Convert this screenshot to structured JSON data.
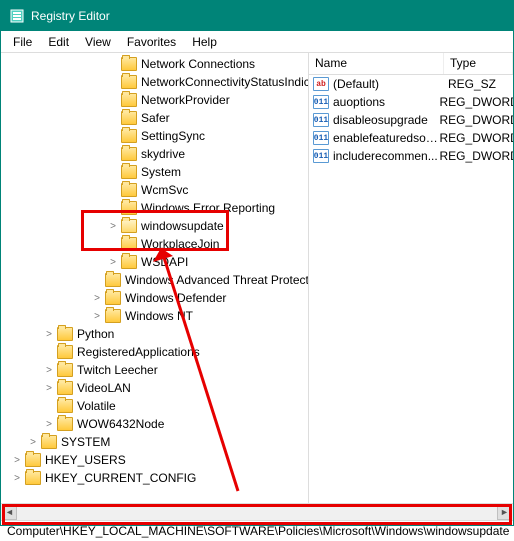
{
  "window": {
    "title": "Registry Editor"
  },
  "menu": {
    "items": [
      "File",
      "Edit",
      "View",
      "Favorites",
      "Help"
    ]
  },
  "tree": {
    "items": [
      {
        "indent": 106,
        "expander": "",
        "label": "Network Connections"
      },
      {
        "indent": 106,
        "expander": "",
        "label": "NetworkConnectivityStatusIndicator"
      },
      {
        "indent": 106,
        "expander": "",
        "label": "NetworkProvider"
      },
      {
        "indent": 106,
        "expander": "",
        "label": "Safer"
      },
      {
        "indent": 106,
        "expander": "",
        "label": "SettingSync"
      },
      {
        "indent": 106,
        "expander": "",
        "label": "skydrive"
      },
      {
        "indent": 106,
        "expander": "",
        "label": "System"
      },
      {
        "indent": 106,
        "expander": "",
        "label": "WcmSvc"
      },
      {
        "indent": 106,
        "expander": "",
        "label": "Windows Error Reporting"
      },
      {
        "indent": 106,
        "expander": ">",
        "label": "windowsupdate",
        "open": true
      },
      {
        "indent": 106,
        "expander": "",
        "label": "WorkplaceJoin"
      },
      {
        "indent": 106,
        "expander": ">",
        "label": "WSDAPI"
      },
      {
        "indent": 90,
        "expander": "",
        "label": "Windows Advanced Threat Protection"
      },
      {
        "indent": 90,
        "expander": ">",
        "label": "Windows Defender"
      },
      {
        "indent": 90,
        "expander": ">",
        "label": "Windows NT"
      },
      {
        "indent": 42,
        "expander": ">",
        "label": "Python"
      },
      {
        "indent": 42,
        "expander": "",
        "label": "RegisteredApplications"
      },
      {
        "indent": 42,
        "expander": ">",
        "label": "Twitch Leecher"
      },
      {
        "indent": 42,
        "expander": ">",
        "label": "VideoLAN"
      },
      {
        "indent": 42,
        "expander": "",
        "label": "Volatile"
      },
      {
        "indent": 42,
        "expander": ">",
        "label": "WOW6432Node"
      },
      {
        "indent": 26,
        "expander": ">",
        "label": "SYSTEM"
      },
      {
        "indent": 10,
        "expander": ">",
        "label": "HKEY_USERS"
      },
      {
        "indent": 10,
        "expander": ">",
        "label": "HKEY_CURRENT_CONFIG"
      }
    ]
  },
  "list": {
    "columns": {
      "name": "Name",
      "type": "Type"
    },
    "rows": [
      {
        "icon": "sz",
        "name": "(Default)",
        "type": "REG_SZ"
      },
      {
        "icon": "dw",
        "name": "auoptions",
        "type": "REG_DWORD"
      },
      {
        "icon": "dw",
        "name": "disableosupgrade",
        "type": "REG_DWORD"
      },
      {
        "icon": "dw",
        "name": "enablefeaturedsoft...",
        "type": "REG_DWORD"
      },
      {
        "icon": "dw",
        "name": "includerecommen...",
        "type": "REG_DWORD"
      }
    ]
  },
  "statusbar": {
    "path": "Computer\\HKEY_LOCAL_MACHINE\\SOFTWARE\\Policies\\Microsoft\\Windows\\windowsupdate"
  }
}
